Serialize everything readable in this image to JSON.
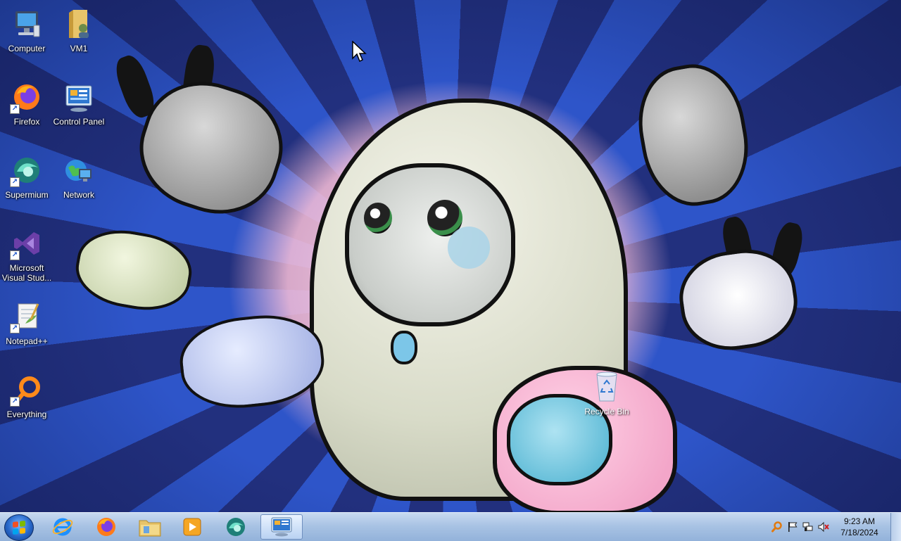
{
  "desktop": {
    "icons": [
      {
        "label": "Computer"
      },
      {
        "label": "VM1"
      },
      {
        "label": "Firefox"
      },
      {
        "label": "Control Panel"
      },
      {
        "label": "Supermium"
      },
      {
        "label": "Network"
      },
      {
        "label": "Microsoft Visual Stud..."
      },
      {
        "label": "Notepad++"
      },
      {
        "label": "Everything"
      }
    ],
    "recycle_bin": {
      "label": "Recycle Bin"
    }
  },
  "taskbar": {
    "start_icon": "windows-logo-icon",
    "pinned": [
      {
        "name": "internet-explorer-icon"
      },
      {
        "name": "firefox-icon"
      },
      {
        "name": "file-explorer-icon"
      },
      {
        "name": "media-player-icon"
      },
      {
        "name": "supermium-icon"
      },
      {
        "name": "control-panel-icon",
        "active": true
      }
    ],
    "tray": {
      "icons": [
        "search-icon",
        "action-center-flag-icon",
        "network-icon",
        "volume-muted-icon"
      ],
      "time": "9:23 AM",
      "date": "7/18/2024"
    }
  },
  "colors": {
    "accent": "#2767c9",
    "taskbar": "#a9c3e4"
  }
}
